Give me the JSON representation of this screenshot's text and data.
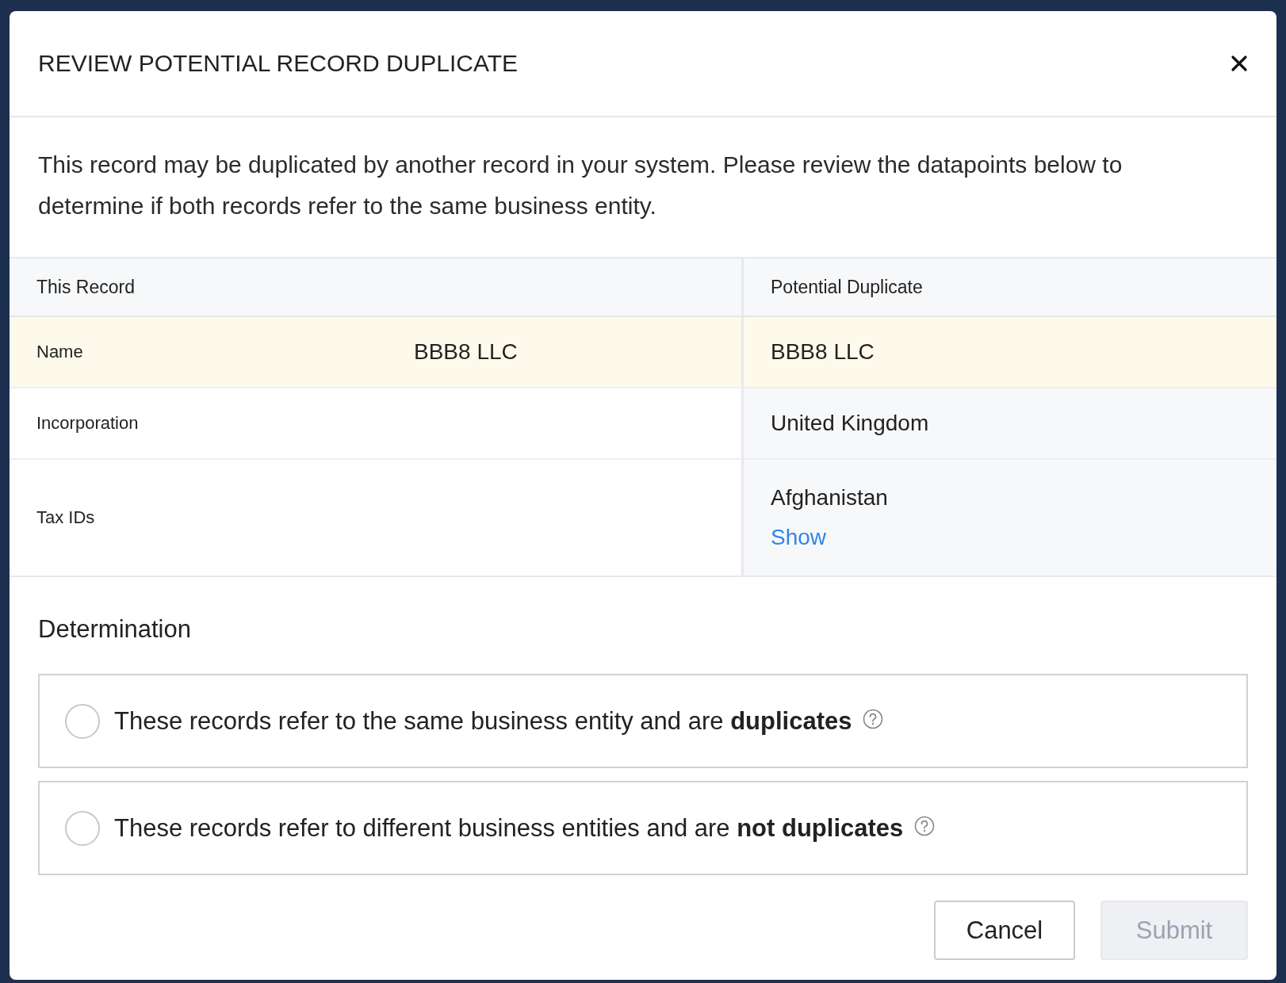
{
  "dialog": {
    "title": "REVIEW POTENTIAL RECORD DUPLICATE",
    "description": "This record may be duplicated by another record in your system. Please review the datapoints below to determine if both records refer to the same business entity."
  },
  "table": {
    "columns": [
      "This Record",
      "Potential Duplicate"
    ],
    "rows": [
      {
        "label": "Name",
        "this_record": "BBB8 LLC",
        "duplicate": "BBB8 LLC",
        "highlighted": true
      },
      {
        "label": "Incorporation",
        "duplicate": "United Kingdom",
        "highlighted": false
      },
      {
        "label": "Tax IDs",
        "duplicate": "Afghanistan",
        "link": "Show",
        "highlighted": false
      }
    ]
  },
  "determination": {
    "heading": "Determination",
    "options": [
      {
        "text": "These records refer to the same business entity and are **duplicates**",
        "selected": false
      },
      {
        "text": "These records refer to different business entities and are **not duplicates**",
        "selected": false
      }
    ]
  },
  "buttons": [
    {
      "label": "Cancel",
      "disabled": false
    },
    {
      "label": "Submit",
      "disabled": true
    }
  ]
}
